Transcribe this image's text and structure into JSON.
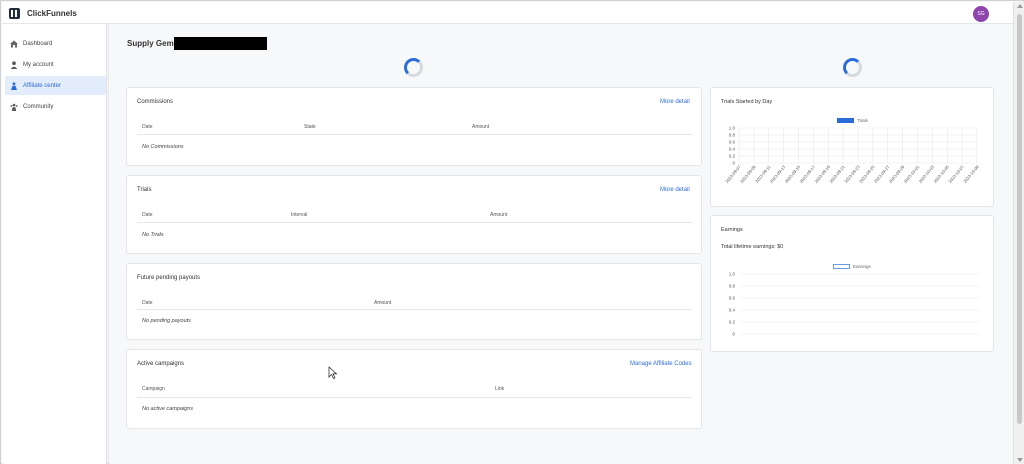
{
  "app": {
    "brand": "ClickFunnels",
    "avatar_initials": "SG"
  },
  "sidebar": {
    "items": [
      {
        "label": "Dashboard",
        "icon": "home-icon"
      },
      {
        "label": "My account",
        "icon": "user-icon"
      },
      {
        "label": "Affiliate center",
        "icon": "affiliate-icon",
        "active": true
      },
      {
        "label": "Community",
        "icon": "community-icon"
      }
    ]
  },
  "page": {
    "title": "Supply Gem"
  },
  "commissions": {
    "title": "Commissions",
    "link": "More detail",
    "columns": [
      "Date",
      "State",
      "Amount"
    ],
    "empty": "No Commissions"
  },
  "trials": {
    "title": "Trials",
    "link": "More detail",
    "columns": [
      "Date",
      "Interval",
      "Amount"
    ],
    "empty": "No Trials"
  },
  "payouts": {
    "title": "Future pending payouts",
    "columns": [
      "Date",
      "Amount"
    ],
    "empty": "No pending payouts"
  },
  "campaigns": {
    "title": "Active campaigns",
    "link": "Manage Affiliate Codes",
    "columns": [
      "Campaign",
      "Link"
    ],
    "empty": "No active campaigns"
  },
  "trials_chart": {
    "title": "Trials Started by Day"
  },
  "earnings": {
    "title": "Earnings",
    "total": "Total lifetime earnings: $0"
  },
  "colors": {
    "accent": "#2b6cd8",
    "avatar": "#8e44ad"
  },
  "chart_data": [
    {
      "type": "bar",
      "title": "Trials Started by Day",
      "series": [
        {
          "name": "Trials",
          "values": [
            0,
            0,
            0,
            0,
            0,
            0,
            0,
            0,
            0,
            0,
            0,
            0,
            0,
            0,
            0,
            0,
            0
          ]
        }
      ],
      "categories": [
        "2023-09-07",
        "2023-09-09",
        "2023-09-11",
        "2023-09-13",
        "2023-09-15",
        "2023-09-17",
        "2023-09-19",
        "2023-09-21",
        "2023-09-23",
        "2023-09-25",
        "2023-09-27",
        "2023-09-29",
        "2023-10-01",
        "2023-10-03",
        "2023-10-05",
        "2023-10-07",
        "2023-10-09"
      ],
      "yticks": [
        "1.0",
        "0.8",
        "0.6",
        "0.4",
        "0.2",
        "0"
      ],
      "ylim": [
        0,
        1
      ],
      "grid": true,
      "legend": "top"
    },
    {
      "type": "line",
      "title": "Earnings",
      "series": [
        {
          "name": "Earnings",
          "values": []
        }
      ],
      "yticks": [
        "1.0",
        "0.8",
        "0.6",
        "0.4",
        "0.2",
        "0"
      ],
      "ylim": [
        0,
        1
      ],
      "grid": true,
      "legend": "top"
    }
  ]
}
